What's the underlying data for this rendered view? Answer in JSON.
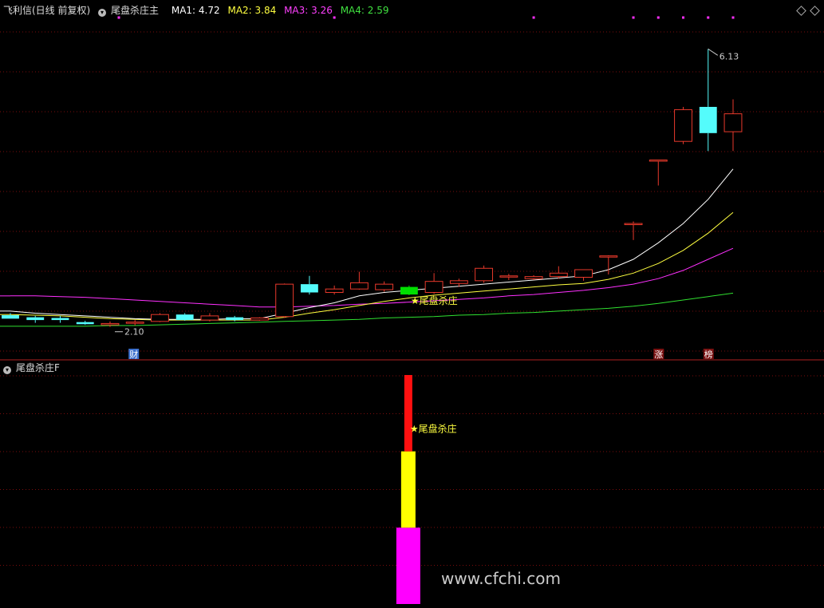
{
  "header_main": {
    "stock": "飞利信(日线 前复权)",
    "indicator": "尾盘杀庄主",
    "ma1": "MA1: 4.72",
    "ma2": "MA2: 3.84",
    "ma3": "MA3: 3.26",
    "ma4": "MA4: 2.59"
  },
  "header_sub": {
    "indicator": "尾盘杀庄F"
  },
  "watermark": "www.cfchi.com",
  "colors": {
    "up": "#e8392b",
    "down": "#54fcfc",
    "signal": "#00e000",
    "ma1": "#ffffff",
    "ma2": "#ffff40",
    "ma3": "#ff30ff",
    "ma4": "#30e030",
    "grid": "#7a0c0c",
    "bar_top": "#ff1010",
    "bar_mid": "#ffff00",
    "bar_bot": "#ff00ff"
  },
  "chart_data": [
    {
      "type": "candlestick",
      "title": "尾盘杀庄主",
      "ylim": [
        1.75,
        6.4
      ],
      "ohlc": [
        [
          2.27,
          2.3,
          2.22,
          2.22
        ],
        [
          2.24,
          2.26,
          2.16,
          2.2
        ],
        [
          2.23,
          2.26,
          2.16,
          2.2
        ],
        [
          2.17,
          2.19,
          2.13,
          2.14
        ],
        [
          2.13,
          2.18,
          2.1,
          2.15
        ],
        [
          2.16,
          2.2,
          2.12,
          2.17
        ],
        [
          2.18,
          2.3,
          2.17,
          2.28
        ],
        [
          2.28,
          2.3,
          2.19,
          2.2
        ],
        [
          2.2,
          2.3,
          2.18,
          2.26
        ],
        [
          2.24,
          2.26,
          2.18,
          2.2
        ],
        [
          2.2,
          2.24,
          2.19,
          2.23
        ],
        [
          2.25,
          2.73,
          2.23,
          2.72
        ],
        [
          2.72,
          2.84,
          2.57,
          2.6
        ],
        [
          2.6,
          2.7,
          2.57,
          2.65
        ],
        [
          2.65,
          2.9,
          2.64,
          2.74
        ],
        [
          2.64,
          2.76,
          2.61,
          2.72
        ],
        [
          2.68,
          2.7,
          2.56,
          2.57
        ],
        [
          2.6,
          2.88,
          2.58,
          2.76
        ],
        [
          2.73,
          2.8,
          2.68,
          2.77
        ],
        [
          2.77,
          2.99,
          2.74,
          2.95
        ],
        [
          2.84,
          2.87,
          2.78,
          2.84
        ],
        [
          2.8,
          2.85,
          2.78,
          2.83
        ],
        [
          2.83,
          2.98,
          2.8,
          2.88
        ],
        [
          2.82,
          2.92,
          2.77,
          2.93
        ],
        [
          3.13,
          3.14,
          2.86,
          3.13
        ],
        [
          3.59,
          3.63,
          3.36,
          3.6
        ],
        [
          4.52,
          4.52,
          4.15,
          4.52
        ],
        [
          4.79,
          5.29,
          4.75,
          5.25
        ],
        [
          5.29,
          6.13,
          4.65,
          4.91
        ],
        [
          4.93,
          5.4,
          4.65,
          5.19
        ]
      ],
      "ma1": [
        2.33,
        2.3,
        2.28,
        2.26,
        2.24,
        2.22,
        2.21,
        2.21,
        2.21,
        2.22,
        2.22,
        2.3,
        2.38,
        2.45,
        2.55,
        2.6,
        2.63,
        2.66,
        2.69,
        2.72,
        2.75,
        2.78,
        2.81,
        2.84,
        2.93,
        3.08,
        3.32,
        3.6,
        3.95,
        4.39
      ],
      "ma2": [
        2.28,
        2.27,
        2.26,
        2.24,
        2.22,
        2.21,
        2.2,
        2.2,
        2.2,
        2.2,
        2.2,
        2.24,
        2.3,
        2.35,
        2.41,
        2.47,
        2.52,
        2.56,
        2.59,
        2.62,
        2.65,
        2.68,
        2.71,
        2.73,
        2.79,
        2.88,
        3.02,
        3.21,
        3.46,
        3.76
      ],
      "ma3": [
        2.55,
        2.55,
        2.54,
        2.53,
        2.51,
        2.49,
        2.47,
        2.45,
        2.43,
        2.41,
        2.39,
        2.39,
        2.4,
        2.41,
        2.43,
        2.44,
        2.46,
        2.48,
        2.5,
        2.52,
        2.55,
        2.57,
        2.6,
        2.63,
        2.67,
        2.72,
        2.8,
        2.92,
        3.08,
        3.24
      ],
      "ma4": [
        2.11,
        2.11,
        2.11,
        2.11,
        2.12,
        2.12,
        2.13,
        2.14,
        2.15,
        2.16,
        2.17,
        2.18,
        2.19,
        2.2,
        2.21,
        2.23,
        2.24,
        2.25,
        2.27,
        2.28,
        2.3,
        2.31,
        2.33,
        2.35,
        2.37,
        2.4,
        2.44,
        2.49,
        2.54,
        2.59
      ],
      "low_label": "2.10",
      "high_label": "6.13",
      "signal_label": "★尾盘杀庄",
      "badges": [
        "财",
        "涨",
        "榜"
      ]
    },
    {
      "type": "stacked-bar",
      "title": "尾盘杀庄F",
      "ylim": [
        0,
        3
      ],
      "segments": [
        1,
        1,
        1
      ],
      "label": "★尾盘杀庄"
    }
  ]
}
